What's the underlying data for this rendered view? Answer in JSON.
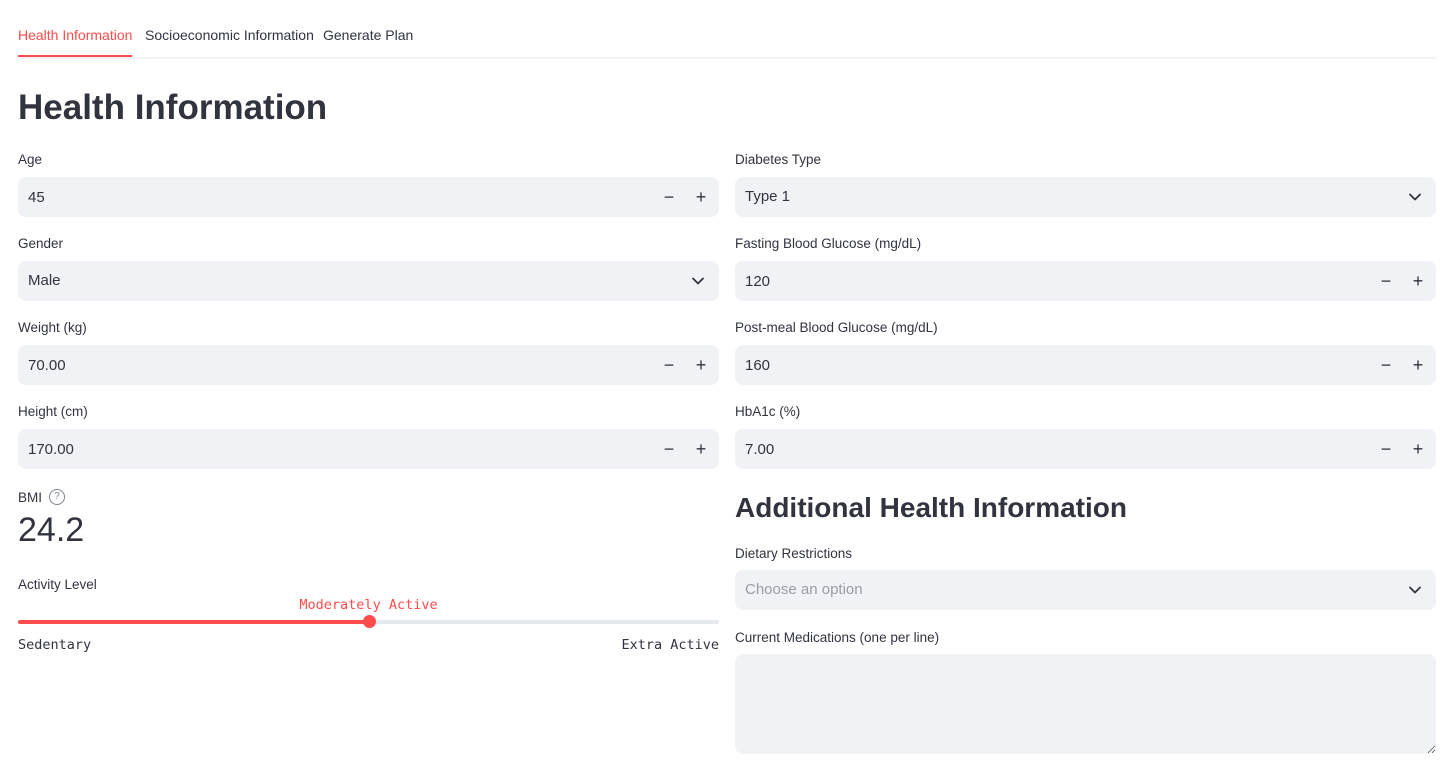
{
  "tabs": [
    {
      "label": "Health Information"
    },
    {
      "label": "Socioeconomic Information"
    },
    {
      "label": "Generate Plan"
    }
  ],
  "page_title": "Health Information",
  "left": {
    "age": {
      "label": "Age",
      "value": "45"
    },
    "gender": {
      "label": "Gender",
      "value": "Male"
    },
    "weight": {
      "label": "Weight (kg)",
      "value": "70.00"
    },
    "height": {
      "label": "Height (cm)",
      "value": "170.00"
    },
    "bmi": {
      "label": "BMI",
      "help_icon": "question-circle-icon",
      "value": "24.2"
    },
    "activity": {
      "label": "Activity Level",
      "value": "Moderately Active",
      "min_label": "Sedentary",
      "max_label": "Extra Active",
      "fraction": 0.5
    }
  },
  "right": {
    "diabetes_type": {
      "label": "Diabetes Type",
      "value": "Type 1"
    },
    "fasting": {
      "label": "Fasting Blood Glucose (mg/dL)",
      "value": "120"
    },
    "postmeal": {
      "label": "Post-meal Blood Glucose (mg/dL)",
      "value": "160"
    },
    "hba1c": {
      "label": "HbA1c (%)",
      "value": "7.00"
    },
    "additional_title": "Additional Health Information",
    "dietary": {
      "label": "Dietary Restrictions",
      "placeholder": "Choose an option"
    },
    "medications": {
      "label": "Current Medications (one per line)",
      "value": ""
    }
  },
  "stepper": {
    "minus": "−",
    "plus": "+"
  },
  "colors": {
    "accent": "#ff4b4b",
    "field_bg": "#f0f2f6",
    "text": "#31333f"
  }
}
